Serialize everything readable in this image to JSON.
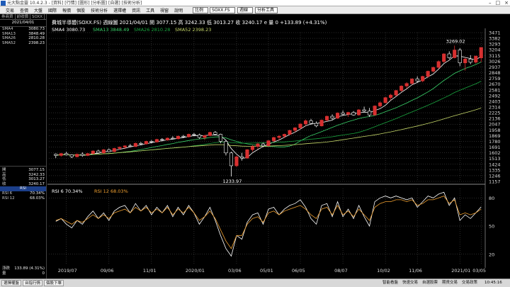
{
  "window": {
    "title": "元大點金靈 10.4.2.3 - [資料] [行情] [圖形] [分析圖] [自選] [技術分析]"
  },
  "menubar": {
    "items": [
      "交易",
      "查價",
      "大盤",
      "國際",
      "報價",
      "個股",
      "技術分析",
      "選擇權",
      "資訊",
      "工具",
      "視窗",
      "說明"
    ],
    "symbol_combo": "SOXX.FS",
    "market_combo": "比例",
    "period_combo": "週線",
    "tool_combo": "分析工具"
  },
  "left_panel": {
    "tabs": [
      "券商資",
      "前收價",
      "SOXX"
    ],
    "date": "2021/04/01",
    "sma": [
      {
        "label": "SMA4",
        "value": "3080.73"
      },
      {
        "label": "SMA13",
        "value": "3848.49"
      },
      {
        "label": "SMA26",
        "value": "2810.28"
      },
      {
        "label": "SMA52",
        "value": "2398.23"
      }
    ],
    "ohlc": [
      {
        "label": "開",
        "value": "3077.15"
      },
      {
        "label": "高",
        "value": "3242.33"
      },
      {
        "label": "低",
        "value": "3013.27"
      },
      {
        "label": "收",
        "value": "3240.17"
      }
    ],
    "rsi_header": "RSI",
    "rsi": [
      {
        "label": "RSI 6",
        "value": "70.34%"
      },
      {
        "label": "RSI 12",
        "value": "68.03%"
      }
    ],
    "footer": [
      {
        "label": "漲跌",
        "value": "133.89 (4.31%)"
      },
      {
        "label": "量",
        "value": "0"
      }
    ]
  },
  "chart_header": "費城半導體(SOXX.FS)   週線圖   2021/04/01  開 3077.15  高 3242.33  低 3013.27  收 3240.17 e  量 0  +133.89 (+4.31%)",
  "ma_legend": [
    {
      "label": "SMA4",
      "value": "3080.73",
      "color": "#ffffff"
    },
    {
      "label": "SMA13",
      "value": "3848.49",
      "color": "#3ad36a"
    },
    {
      "label": "SMA26",
      "value": "2810.28",
      "color": "#1aa53f"
    },
    {
      "label": "SMA52",
      "value": "2398.23",
      "color": "#c6d86a"
    }
  ],
  "rsi_legend": [
    {
      "label": "RSI 6",
      "value": "70.34%",
      "color": "#ffffff"
    },
    {
      "label": "RSI 12",
      "value": "68.03%",
      "color": "#f0a030"
    }
  ],
  "chart_data": [
    {
      "type": "candlestick",
      "title": "費城半導體(SOXX.FS) 週線圖",
      "y_ticks": [
        3471,
        3382,
        3293,
        3204,
        3115,
        3026,
        2937,
        2848,
        2759,
        2670,
        2581,
        2492,
        2403,
        2314,
        2225,
        2136,
        2047,
        1958,
        1869,
        1780,
        1691,
        1602,
        1513,
        1424,
        1335,
        1246,
        1157
      ],
      "ylim": [
        1157,
        3471
      ],
      "x_labels": [
        "2019/07",
        "09/06",
        "11/01",
        "2020/01",
        "03/06",
        "05/01",
        "06/05",
        "08/07",
        "10/02",
        "11/06",
        "2021/01",
        "03/05"
      ],
      "annotations": [
        {
          "text": "3269.02",
          "value": 3269.02
        },
        {
          "text": "1233.97",
          "value": 1233.97
        }
      ],
      "candles": [
        [
          1580,
          1590,
          1520,
          1560
        ],
        [
          1560,
          1600,
          1540,
          1590
        ],
        [
          1590,
          1620,
          1560,
          1570
        ],
        [
          1570,
          1580,
          1520,
          1540
        ],
        [
          1540,
          1590,
          1530,
          1580
        ],
        [
          1580,
          1610,
          1540,
          1560
        ],
        [
          1560,
          1600,
          1550,
          1590
        ],
        [
          1590,
          1640,
          1580,
          1630
        ],
        [
          1630,
          1650,
          1590,
          1600
        ],
        [
          1600,
          1660,
          1590,
          1650
        ],
        [
          1650,
          1670,
          1610,
          1620
        ],
        [
          1620,
          1680,
          1610,
          1670
        ],
        [
          1670,
          1700,
          1650,
          1690
        ],
        [
          1690,
          1720,
          1660,
          1710
        ],
        [
          1710,
          1740,
          1690,
          1700
        ],
        [
          1700,
          1760,
          1690,
          1750
        ],
        [
          1750,
          1770,
          1720,
          1740
        ],
        [
          1740,
          1790,
          1730,
          1780
        ],
        [
          1780,
          1800,
          1750,
          1770
        ],
        [
          1770,
          1820,
          1760,
          1810
        ],
        [
          1810,
          1830,
          1780,
          1800
        ],
        [
          1800,
          1840,
          1790,
          1830
        ],
        [
          1830,
          1860,
          1810,
          1820
        ],
        [
          1820,
          1870,
          1810,
          1860
        ],
        [
          1860,
          1880,
          1830,
          1850
        ],
        [
          1850,
          1900,
          1840,
          1890
        ],
        [
          1890,
          1910,
          1860,
          1880
        ],
        [
          1880,
          1900,
          1820,
          1840
        ],
        [
          1840,
          1880,
          1800,
          1870
        ],
        [
          1870,
          1930,
          1860,
          1920
        ],
        [
          1920,
          1940,
          1880,
          1890
        ],
        [
          1890,
          1900,
          1750,
          1780
        ],
        [
          1780,
          1800,
          1560,
          1600
        ],
        [
          1600,
          1620,
          1233.97,
          1400
        ],
        [
          1400,
          1560,
          1380,
          1540
        ],
        [
          1540,
          1600,
          1480,
          1520
        ],
        [
          1520,
          1660,
          1510,
          1650
        ],
        [
          1650,
          1720,
          1620,
          1700
        ],
        [
          1700,
          1760,
          1660,
          1740
        ],
        [
          1740,
          1760,
          1690,
          1710
        ],
        [
          1710,
          1800,
          1700,
          1790
        ],
        [
          1790,
          1850,
          1770,
          1840
        ],
        [
          1840,
          1880,
          1800,
          1860
        ],
        [
          1860,
          1900,
          1830,
          1890
        ],
        [
          1890,
          1960,
          1880,
          1950
        ],
        [
          1950,
          2000,
          1920,
          1990
        ],
        [
          1990,
          2060,
          1970,
          2050
        ],
        [
          2050,
          2120,
          2020,
          2100
        ],
        [
          2100,
          2130,
          2040,
          2060
        ],
        [
          2060,
          2090,
          2000,
          2020
        ],
        [
          2020,
          2120,
          2010,
          2110
        ],
        [
          2110,
          2180,
          2090,
          2170
        ],
        [
          2170,
          2200,
          2120,
          2140
        ],
        [
          2140,
          2230,
          2130,
          2220
        ],
        [
          2220,
          2260,
          2180,
          2200
        ],
        [
          2200,
          2240,
          2160,
          2230
        ],
        [
          2230,
          2250,
          2180,
          2190
        ],
        [
          2190,
          2280,
          2180,
          2270
        ],
        [
          2270,
          2320,
          2230,
          2250
        ],
        [
          2250,
          2300,
          2160,
          2190
        ],
        [
          2190,
          2340,
          2180,
          2330
        ],
        [
          2330,
          2400,
          2310,
          2380
        ],
        [
          2380,
          2470,
          2370,
          2460
        ],
        [
          2460,
          2520,
          2420,
          2500
        ],
        [
          2500,
          2580,
          2480,
          2570
        ],
        [
          2570,
          2650,
          2550,
          2640
        ],
        [
          2640,
          2700,
          2600,
          2680
        ],
        [
          2680,
          2760,
          2660,
          2750
        ],
        [
          2750,
          2790,
          2690,
          2720
        ],
        [
          2720,
          2800,
          2700,
          2790
        ],
        [
          2790,
          2880,
          2770,
          2870
        ],
        [
          2870,
          2940,
          2850,
          2930
        ],
        [
          2930,
          3040,
          2910,
          3020
        ],
        [
          3020,
          3150,
          3000,
          3140
        ],
        [
          3140,
          3180,
          3060,
          3080
        ],
        [
          3080,
          3269.02,
          3070,
          3200
        ],
        [
          3200,
          3230,
          2950,
          3000
        ],
        [
          3000,
          3080,
          2880,
          3060
        ],
        [
          3060,
          3120,
          2980,
          3010
        ],
        [
          3010,
          3110,
          2990,
          3106.28
        ],
        [
          3077.15,
          3242.33,
          3013.27,
          3240.17
        ]
      ]
    },
    {
      "type": "line",
      "title": "RSI",
      "y_ticks": [
        80,
        50,
        20
      ],
      "ylim": [
        10,
        90
      ],
      "series": [
        {
          "name": "RSI 6",
          "values": [
            55,
            58,
            52,
            48,
            56,
            52,
            60,
            66,
            58,
            64,
            56,
            66,
            70,
            72,
            64,
            74,
            66,
            72,
            62,
            70,
            64,
            72,
            60,
            70,
            62,
            72,
            64,
            52,
            60,
            70,
            56,
            40,
            26,
            18,
            40,
            36,
            54,
            62,
            64,
            52,
            68,
            70,
            62,
            68,
            72,
            74,
            78,
            70,
            58,
            52,
            72,
            74,
            60,
            76,
            60,
            68,
            58,
            72,
            60,
            50,
            76,
            80,
            82,
            80,
            82,
            80,
            78,
            80,
            70,
            76,
            82,
            80,
            84,
            86,
            72,
            80,
            56,
            62,
            58,
            64,
            70.34
          ]
        },
        {
          "name": "RSI 12",
          "values": [
            56,
            58,
            55,
            52,
            56,
            54,
            58,
            62,
            58,
            62,
            58,
            64,
            66,
            68,
            64,
            70,
            66,
            70,
            64,
            68,
            64,
            70,
            62,
            68,
            64,
            70,
            64,
            56,
            60,
            66,
            58,
            46,
            34,
            26,
            40,
            40,
            52,
            58,
            60,
            54,
            64,
            66,
            62,
            66,
            68,
            70,
            72,
            68,
            62,
            58,
            68,
            70,
            62,
            72,
            62,
            66,
            60,
            68,
            62,
            56,
            70,
            74,
            76,
            76,
            78,
            78,
            76,
            78,
            72,
            74,
            78,
            78,
            80,
            82,
            74,
            78,
            62,
            64,
            62,
            64,
            68.03
          ]
        }
      ]
    }
  ],
  "status_bar": {
    "buttons": [
      "選擇權盤",
      "台指行情",
      "個股下單"
    ],
    "right": [
      "智能看盤",
      "快速交易",
      "自選股票",
      "期貨交易",
      "交易政策"
    ],
    "time": "10:45:16"
  },
  "colors": {
    "up": "#d83030",
    "down": "#ffffff",
    "grid": "#555555",
    "background": "#000000"
  }
}
